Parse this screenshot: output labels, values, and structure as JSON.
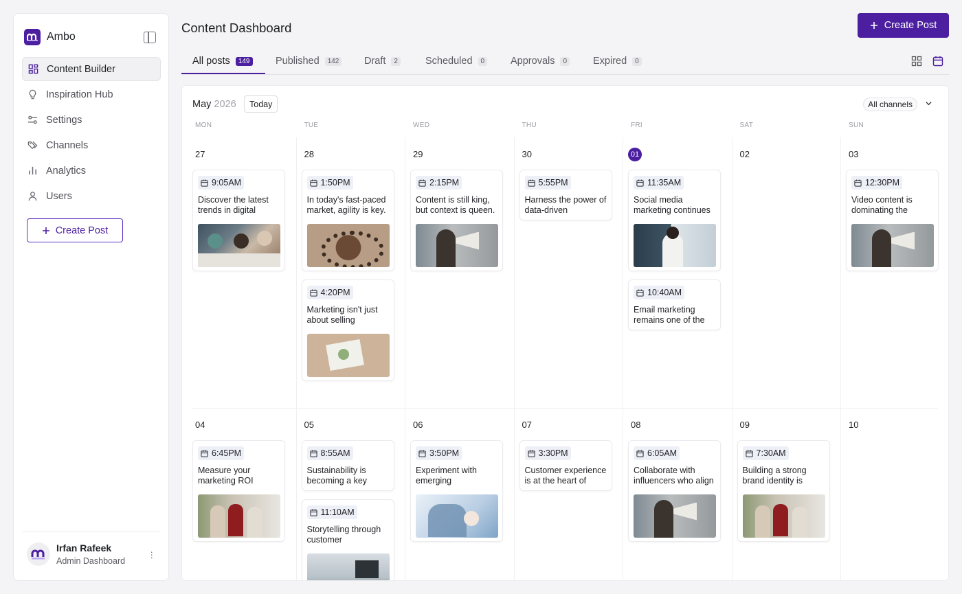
{
  "sidebar": {
    "brand": "Ambo",
    "nav": [
      {
        "label": "Content Builder",
        "icon": "grid-icon",
        "active": true
      },
      {
        "label": "Inspiration Hub",
        "icon": "lightbulb-icon"
      },
      {
        "label": "Settings",
        "icon": "sliders-icon"
      },
      {
        "label": "Channels",
        "icon": "tags-icon"
      },
      {
        "label": "Analytics",
        "icon": "bar-chart-icon"
      },
      {
        "label": "Users",
        "icon": "user-icon"
      }
    ],
    "create_label": "Create Post",
    "user": {
      "name": "Irfan Rafeek",
      "role": "Admin Dashboard"
    }
  },
  "header": {
    "title": "Content Dashboard",
    "create_label": "Create Post"
  },
  "tabs": [
    {
      "label": "All posts",
      "count": "149",
      "active": true
    },
    {
      "label": "Published",
      "count": "142"
    },
    {
      "label": "Draft",
      "count": "2"
    },
    {
      "label": "Scheduled",
      "count": "0"
    },
    {
      "label": "Approvals",
      "count": "0"
    },
    {
      "label": "Expired",
      "count": "0"
    }
  ],
  "calendar": {
    "month": "May",
    "year": "2026",
    "today_label": "Today",
    "channels_label": "All channels",
    "weekdays": [
      "MON",
      "TUE",
      "WED",
      "THU",
      "FRI",
      "SAT",
      "SUN"
    ],
    "weeks": [
      [
        "27",
        "28",
        "29",
        "30",
        "01",
        "02",
        "03"
      ],
      [
        "04",
        "05",
        "06",
        "07",
        "08",
        "09",
        "10"
      ]
    ],
    "posts": [
      {
        "week": 0,
        "day": 0,
        "time": "9:05AM",
        "text": "Discover the latest trends in digital",
        "image": "meeting"
      },
      {
        "week": 0,
        "day": 1,
        "time": "1:50PM",
        "text": "In today's fast-paced market, agility is key.",
        "image": "table"
      },
      {
        "week": 0,
        "day": 1,
        "time": "4:20PM",
        "text": "Marketing isn't just about selling",
        "image": "papers"
      },
      {
        "week": 0,
        "day": 2,
        "time": "2:15PM",
        "text": "Content is still king, but context is queen.",
        "image": "megaphone"
      },
      {
        "week": 0,
        "day": 3,
        "time": "5:55PM",
        "text": "Harness the power of data-driven",
        "image": ""
      },
      {
        "week": 0,
        "day": 4,
        "time": "11:35AM",
        "text": "Social media marketing continues",
        "image": "celebrate"
      },
      {
        "week": 0,
        "day": 4,
        "time": "10:40AM",
        "text": "Email marketing remains one of the",
        "image": ""
      },
      {
        "week": 0,
        "day": 6,
        "time": "12:30PM",
        "text": "Video content is dominating the",
        "image": "megaphone"
      },
      {
        "week": 1,
        "day": 0,
        "time": "6:45PM",
        "text": "Measure your marketing ROI",
        "image": "walk"
      },
      {
        "week": 1,
        "day": 1,
        "time": "8:55AM",
        "text": "Sustainability is becoming a key",
        "image": ""
      },
      {
        "week": 1,
        "day": 1,
        "time": "11:10AM",
        "text": "Storytelling through customer",
        "image": "office"
      },
      {
        "week": 1,
        "day": 2,
        "time": "3:50PM",
        "text": "Experiment with emerging",
        "image": "graph"
      },
      {
        "week": 1,
        "day": 3,
        "time": "3:30PM",
        "text": "Customer experience is at the heart of",
        "image": ""
      },
      {
        "week": 1,
        "day": 4,
        "time": "6:05AM",
        "text": "Collaborate with influencers who align",
        "image": "megaphone"
      },
      {
        "week": 1,
        "day": 5,
        "time": "7:30AM",
        "text": "Building a strong brand identity is",
        "image": "walk"
      }
    ]
  },
  "colors": {
    "accent": "#4b1fa0"
  }
}
